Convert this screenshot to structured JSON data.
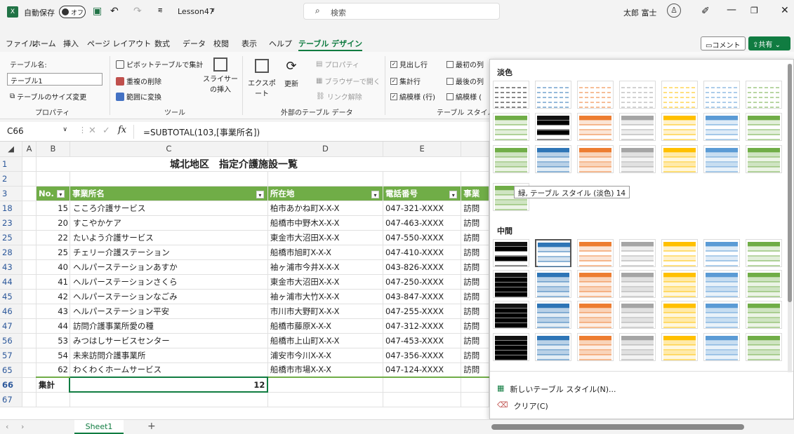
{
  "title": {
    "autosave": "自動保存",
    "toggle": "オフ",
    "filename": "Lesson47",
    "search": "検索",
    "user": "太郎 富士"
  },
  "menu": [
    "ファイル",
    "ホーム",
    "挿入",
    "ページ レイアウト",
    "数式",
    "データ",
    "校閲",
    "表示",
    "ヘルプ",
    "テーブル デザイン"
  ],
  "buttons": {
    "comment": "コメント",
    "share": "共有"
  },
  "ribbon": {
    "props": {
      "name_label": "テーブル名:",
      "name_value": "テーブル1",
      "resize": "テーブルのサイズ変更",
      "group": "プロパティ"
    },
    "tools": {
      "pivot": "ピボットテーブルで集計",
      "dedupe": "重複の削除",
      "range": "範囲に変換",
      "slicer": "スライサーの挿入",
      "group": "ツール"
    },
    "ext": {
      "export": "エクスポート",
      "refresh": "更新",
      "props": "プロパティ",
      "browser": "ブラウザーで開く",
      "unlink": "リンク解除",
      "group": "外部のテーブル データ"
    },
    "opts": {
      "header": "見出し行",
      "total": "集計行",
      "banded": "縞模様 (行)",
      "first": "最初の列",
      "last": "最後の列",
      "bandcol": "縞模様 (",
      "group": "テーブル スタイル"
    }
  },
  "formula": {
    "cell": "C66",
    "value": "=SUBTOTAL(103,[事業所名])"
  },
  "columns": [
    "A",
    "B",
    "C",
    "D",
    "E"
  ],
  "sheet_title": "城北地区　指定介護施設一覧",
  "headers": {
    "no": "No.",
    "name": "事業所名",
    "addr": "所在地",
    "tel": "電話番号",
    "type": "事業"
  },
  "rows": [
    {
      "r": "18",
      "no": "15",
      "name": "こころ介護サービス",
      "addr": "柏市あかね町X-X-X",
      "tel": "047-321-XXXX",
      "t": "訪問"
    },
    {
      "r": "23",
      "no": "20",
      "name": "すこやかケア",
      "addr": "船橋市中野木X-X-X",
      "tel": "047-463-XXXX",
      "t": "訪問"
    },
    {
      "r": "25",
      "no": "22",
      "name": "たいよう介護サービス",
      "addr": "東金市大沼田X-X-X",
      "tel": "047-550-XXXX",
      "t": "訪問"
    },
    {
      "r": "28",
      "no": "25",
      "name": "チェリー介護ステーション",
      "addr": "船橋市旭町X-X-X",
      "tel": "047-410-XXXX",
      "t": "訪問"
    },
    {
      "r": "43",
      "no": "40",
      "name": "ヘルパーステーションあすか",
      "addr": "袖ヶ浦市今井X-X-X",
      "tel": "043-826-XXXX",
      "t": "訪問"
    },
    {
      "r": "44",
      "no": "41",
      "name": "ヘルパーステーションさくら",
      "addr": "東金市大沼田X-X-X",
      "tel": "047-250-XXXX",
      "t": "訪問"
    },
    {
      "r": "45",
      "no": "42",
      "name": "ヘルパーステーションなごみ",
      "addr": "袖ヶ浦市大竹X-X-X",
      "tel": "043-847-XXXX",
      "t": "訪問"
    },
    {
      "r": "46",
      "no": "43",
      "name": "ヘルパーステーション平安",
      "addr": "市川市大野町X-X-X",
      "tel": "047-255-XXXX",
      "t": "訪問"
    },
    {
      "r": "47",
      "no": "44",
      "name": "訪問介護事業所愛の種",
      "addr": "船橋市藤原X-X-X",
      "tel": "047-312-XXXX",
      "t": "訪問"
    },
    {
      "r": "56",
      "no": "53",
      "name": "みつはしサービスセンター",
      "addr": "船橋市上山町X-X-X",
      "tel": "047-453-XXXX",
      "t": "訪問"
    },
    {
      "r": "57",
      "no": "54",
      "name": "未来訪問介護事業所",
      "addr": "浦安市今川X-X-X",
      "tel": "047-356-XXXX",
      "t": "訪問"
    },
    {
      "r": "65",
      "no": "62",
      "name": "わくわくホームサービス",
      "addr": "船橋市市場X-X-X",
      "tel": "047-124-XXXX",
      "t": "訪問"
    }
  ],
  "total": {
    "r": "66",
    "label": "集計",
    "value": "12"
  },
  "gallery": {
    "light": "淡色",
    "medium": "中間",
    "tooltip": "緑, テーブル スタイル (淡色) 14",
    "new_style": "新しいテーブル スタイル(N)...",
    "clear": "クリア(C)"
  },
  "sheet": "Sheet1",
  "colors": {
    "green": "#70ad47",
    "excel": "#217346",
    "select": "#107c41"
  }
}
